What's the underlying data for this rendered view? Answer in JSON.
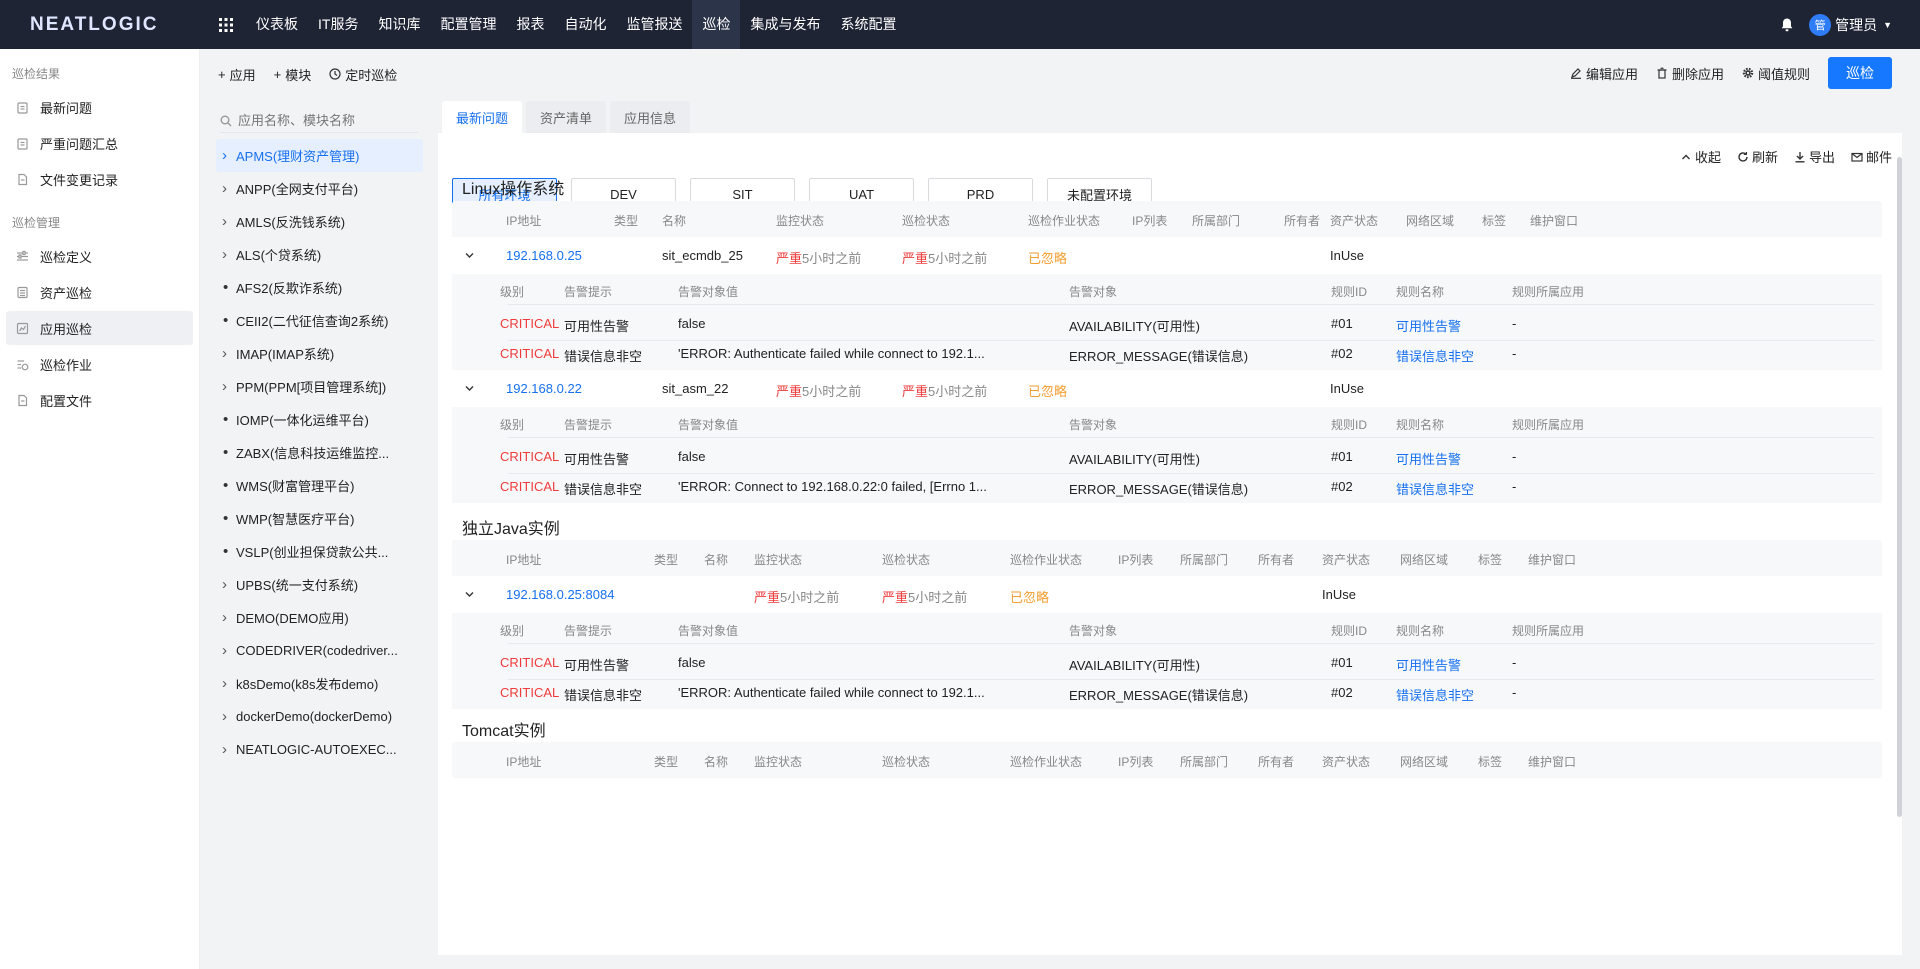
{
  "topbar": {
    "logo": "NEATLOGIC",
    "nav": [
      "仪表板",
      "IT服务",
      "知识库",
      "配置管理",
      "报表",
      "自动化",
      "监管报送",
      "巡检",
      "集成与发布",
      "系统配置"
    ],
    "active_nav": "巡检",
    "user_avatar": "管",
    "user_name": "管理员"
  },
  "sidebar": {
    "group1": "巡检结果",
    "group1_items": [
      "最新问题",
      "严重问题汇总",
      "文件变更记录"
    ],
    "group2": "巡检管理",
    "group2_items": [
      "巡检定义",
      "资产巡检",
      "应用巡检",
      "巡检作业",
      "配置文件"
    ],
    "active_item": "应用巡检"
  },
  "toolbar": {
    "add_app": "应用",
    "add_module": "模块",
    "schedule": "定时巡检",
    "edit_app": "编辑应用",
    "delete_app": "删除应用",
    "threshold": "阈值规则",
    "inspect": "巡检"
  },
  "apptree": {
    "search_placeholder": "应用名称、模块名称",
    "items": [
      {
        "label": "APMS(理财资产管理)",
        "type": "chevron",
        "active": true
      },
      {
        "label": "ANPP(全网支付平台)",
        "type": "chevron"
      },
      {
        "label": "AMLS(反洗钱系统)",
        "type": "chevron"
      },
      {
        "label": "ALS(个贷系统)",
        "type": "chevron"
      },
      {
        "label": "AFS2(反欺诈系统)",
        "type": "dot"
      },
      {
        "label": "CEII2(二代征信查询2系统)",
        "type": "dot"
      },
      {
        "label": "IMAP(IMAP系统)",
        "type": "chevron"
      },
      {
        "label": "PPM(PPM[项目管理系统])",
        "type": "chevron"
      },
      {
        "label": "IOMP(一体化运维平台)",
        "type": "dot"
      },
      {
        "label": "ZABX(信息科技运维监控...",
        "type": "dot"
      },
      {
        "label": "WMS(财富管理平台)",
        "type": "dot"
      },
      {
        "label": "WMP(智慧医疗平台)",
        "type": "dot"
      },
      {
        "label": "VSLP(创业担保贷款公共...",
        "type": "dot"
      },
      {
        "label": "UPBS(统一支付系统)",
        "type": "chevron"
      },
      {
        "label": "DEMO(DEMO应用)",
        "type": "chevron"
      },
      {
        "label": "CODEDRIVER(codedriver...",
        "type": "chevron"
      },
      {
        "label": "k8sDemo(k8s发布demo)",
        "type": "chevron"
      },
      {
        "label": "dockerDemo(dockerDemo)",
        "type": "chevron"
      },
      {
        "label": "NEATLOGIC-AUTOEXEC...",
        "type": "chevron"
      }
    ]
  },
  "tabs": [
    "最新问题",
    "资产清单",
    "应用信息"
  ],
  "panel_actions": [
    "收起",
    "刷新",
    "导出",
    "邮件"
  ],
  "envs": [
    "所有环境",
    "DEV",
    "SIT",
    "UAT",
    "PRD",
    "未配置环境"
  ],
  "columns": [
    "IP地址",
    "类型",
    "名称",
    "监控状态",
    "巡检状态",
    "巡检作业状态",
    "IP列表",
    "所属部门",
    "所有者",
    "资产状态",
    "网络区域",
    "标签",
    "维护窗口"
  ],
  "sub_columns": [
    "级别",
    "告警提示",
    "告警对象值",
    "告警对象",
    "规则ID",
    "规则名称",
    "规则所属应用"
  ],
  "sections": [
    {
      "title": "Linux操作系统",
      "rows": [
        {
          "ip": "192.168.0.25",
          "name": "sit_ecmdb_25",
          "monitor_badge": "严重",
          "monitor_time": "5小时之前",
          "inspect_badge": "严重",
          "inspect_time": "5小时之前",
          "job_status": "已忽略",
          "asset_status": "InUse",
          "alerts": [
            {
              "level": "CRITICAL",
              "hint": "可用性告警",
              "value": "false",
              "object": "AVAILABILITY(可用性)",
              "rule_id": "#01",
              "rule_name": "可用性告警",
              "rule_app": "-"
            },
            {
              "level": "CRITICAL",
              "hint": "错误信息非空",
              "value": "'ERROR: Authenticate failed while connect to 192.1...",
              "object": "ERROR_MESSAGE(错误信息)",
              "rule_id": "#02",
              "rule_name": "错误信息非空",
              "rule_app": "-"
            }
          ]
        },
        {
          "ip": "192.168.0.22",
          "name": "sit_asm_22",
          "monitor_badge": "严重",
          "monitor_time": "5小时之前",
          "inspect_badge": "严重",
          "inspect_time": "5小时之前",
          "job_status": "已忽略",
          "asset_status": "InUse",
          "alerts": [
            {
              "level": "CRITICAL",
              "hint": "可用性告警",
              "value": "false",
              "object": "AVAILABILITY(可用性)",
              "rule_id": "#01",
              "rule_name": "可用性告警",
              "rule_app": "-"
            },
            {
              "level": "CRITICAL",
              "hint": "错误信息非空",
              "value": "'ERROR: Connect to 192.168.0.22:0 failed, [Errno 1...",
              "object": "ERROR_MESSAGE(错误信息)",
              "rule_id": "#02",
              "rule_name": "错误信息非空",
              "rule_app": "-"
            }
          ]
        }
      ]
    },
    {
      "title": "独立Java实例",
      "rows": [
        {
          "ip": "192.168.0.25:8084",
          "name": "",
          "monitor_badge": "严重",
          "monitor_time": "5小时之前",
          "inspect_badge": "严重",
          "inspect_time": "5小时之前",
          "job_status": "已忽略",
          "asset_status": "InUse",
          "alerts": [
            {
              "level": "CRITICAL",
              "hint": "可用性告警",
              "value": "false",
              "object": "AVAILABILITY(可用性)",
              "rule_id": "#01",
              "rule_name": "可用性告警",
              "rule_app": "-"
            },
            {
              "level": "CRITICAL",
              "hint": "错误信息非空",
              "value": "'ERROR: Authenticate failed while connect to 192.1...",
              "object": "ERROR_MESSAGE(错误信息)",
              "rule_id": "#02",
              "rule_name": "错误信息非空",
              "rule_app": "-"
            }
          ]
        }
      ]
    },
    {
      "title": "Tomcat实例",
      "rows": []
    }
  ],
  "colors": {
    "accent": "#1677ff",
    "critical": "#ef3b3b",
    "ignored": "#f29e32",
    "topbar": "#1f2435"
  },
  "icons": [
    "apps-grid-icon",
    "bell-icon",
    "plus-icon",
    "clock-icon",
    "edit-icon",
    "trash-icon",
    "gear-icon",
    "search-icon",
    "chevron-right-icon",
    "chevron-down-icon",
    "refresh-icon",
    "download-icon",
    "mail-icon",
    "collapse-up-icon"
  ]
}
